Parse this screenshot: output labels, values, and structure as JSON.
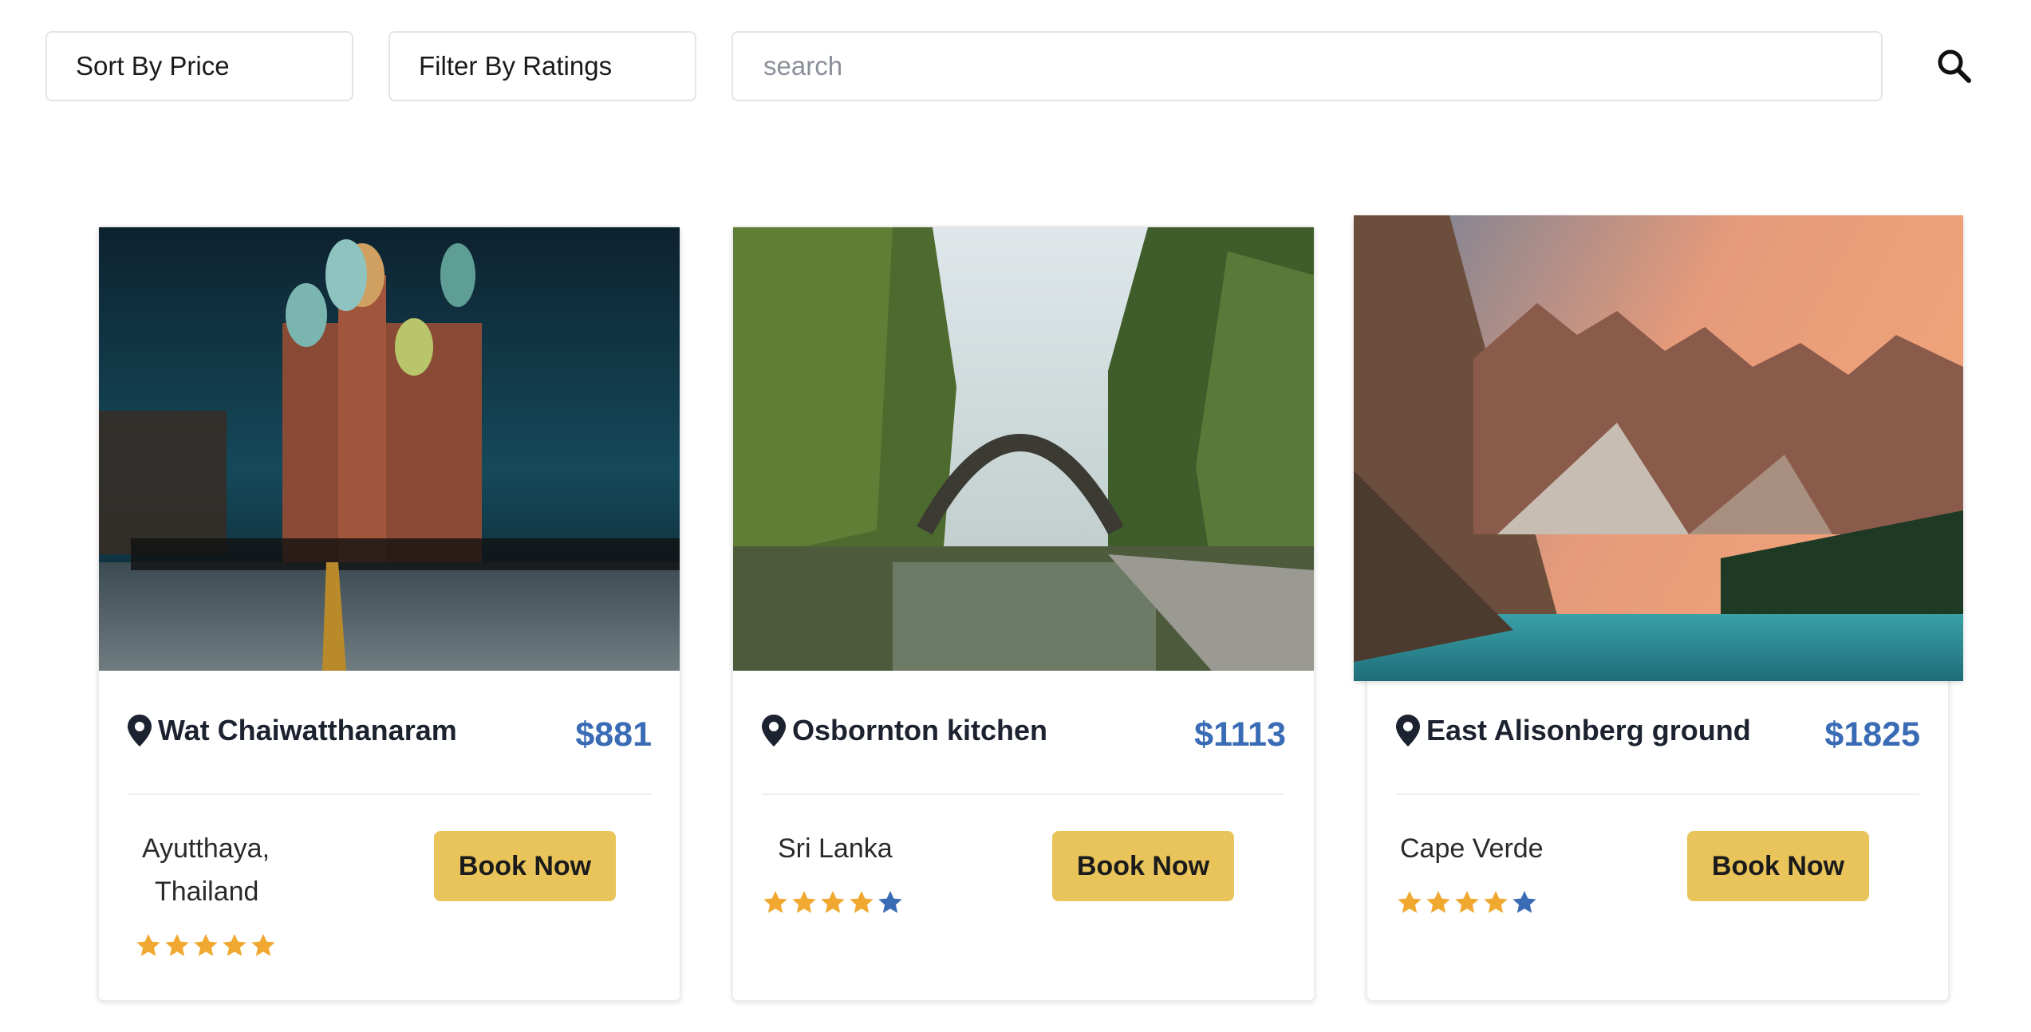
{
  "toolbar": {
    "sort_label": "Sort By Price",
    "filter_label": "Filter By Ratings",
    "search_placeholder": "search",
    "search_value": "",
    "search_icon": "search-icon"
  },
  "colors": {
    "price": "#3a6bb5",
    "button": "#e8c45a",
    "star_filled": "#f0a830",
    "star_empty": "#3a6bb5"
  },
  "cards": [
    {
      "name": "Wat Chaiwatthanaram",
      "price": "$881",
      "location_line1": "Ayutthaya,",
      "location_line2": "Thailand",
      "button": "Book Now",
      "rating": 5,
      "rating_max": 5,
      "image": "night-cathedral-photo"
    },
    {
      "name": "Osbornton kitchen",
      "price": "$1113",
      "location_line1": "Sri Lanka",
      "location_line2": "",
      "button": "Book Now",
      "rating": 4,
      "rating_max": 5,
      "image": "stone-arch-bridge-photo"
    },
    {
      "name": "East Alisonberg ground",
      "price": "$1825",
      "location_line1": "Cape Verde",
      "location_line2": "",
      "button": "Book Now",
      "rating": 4,
      "rating_max": 5,
      "image": "mountain-lake-sunset-photo"
    }
  ]
}
